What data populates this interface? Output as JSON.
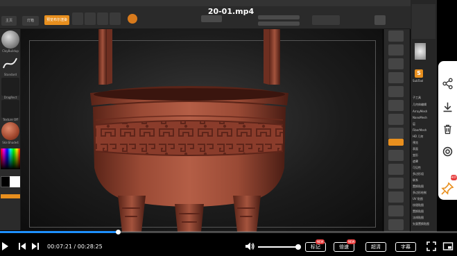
{
  "video": {
    "title": "20-01.mp4",
    "current_time": "00:07:21",
    "separator": "/",
    "duration": "00:28:25",
    "progress": 0.2587,
    "volume": 1.0
  },
  "controls": {
    "play_icon": "play-icon",
    "prev_icon": "previous-icon",
    "next_icon": "next-icon",
    "volume_icon": "volume-icon",
    "fullscreen_icon": "fullscreen-icon",
    "pip_icon": "picture-in-picture-icon",
    "mark_label": "标记",
    "speed_label": "倍速",
    "quality_label": "超清",
    "subtitle_label": "字幕",
    "new_badge": "NEW"
  },
  "side_actions": {
    "icons": [
      "share-icon",
      "download-icon",
      "delete-icon",
      "settings-icon"
    ],
    "pin_icon": "pin-icon",
    "hot_badge": "HOT"
  },
  "zbrush": {
    "top_buttons": [
      "主页",
      "灯箱",
      "预览布尔渲染"
    ],
    "brushes": [
      "ClayBuildup",
      "Standard",
      "DragRect",
      "Alpha Off",
      "Texture Off",
      "SkinShade4"
    ],
    "tool_title": "SubTool",
    "tool_items": [
      "子工具",
      "几何体编辑",
      "ArrayMesh",
      "NanoMesh",
      "层",
      "FiberMesh",
      "HD 几何",
      "预览",
      "表面",
      "变形",
      "遮罩",
      "可见性",
      "多边形组",
      "联系",
      "置换贴图",
      "多边形绘制",
      "UV 贴图",
      "纹理贴图",
      "置换贴图",
      "法线贴图",
      "矢量置换贴图",
      "显示属性",
      "统一蒙皮"
    ]
  },
  "colors": {
    "accent": "#e88f1e",
    "progress": "#1e90ff",
    "badge": "#e63a3a",
    "model": "#8b3a2a"
  }
}
